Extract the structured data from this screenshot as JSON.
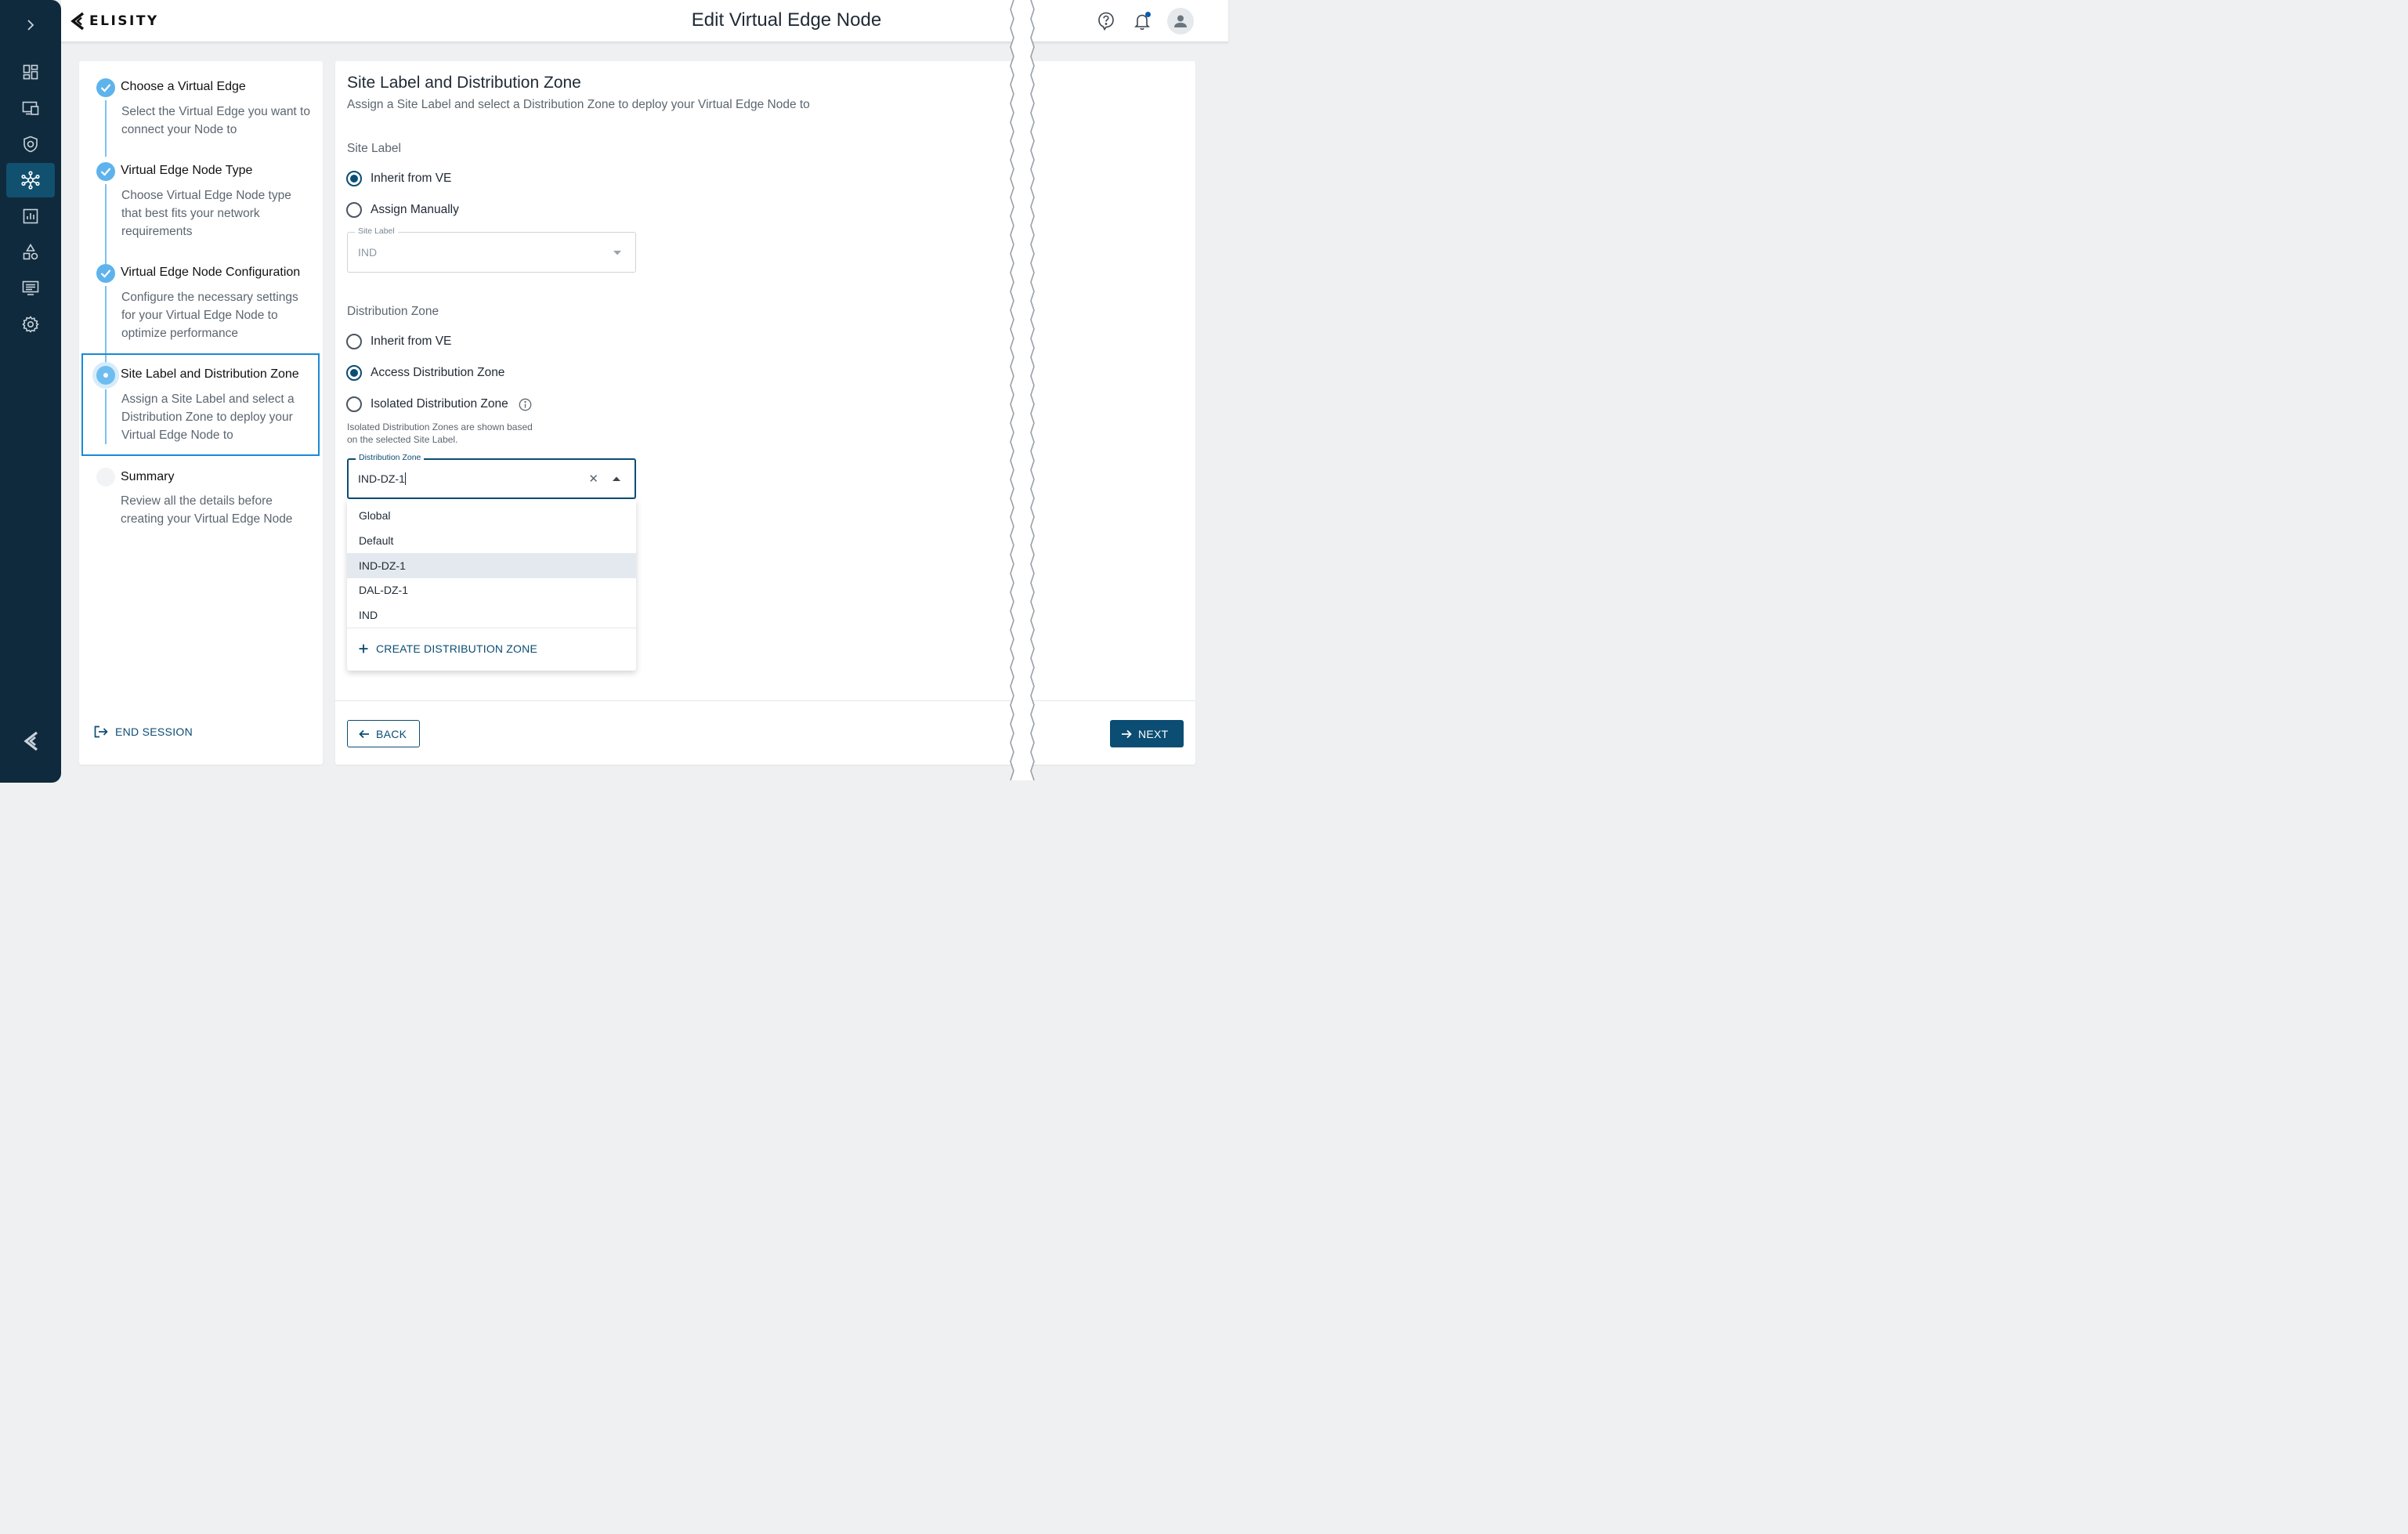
{
  "app": {
    "brand": "ELISITY",
    "page_title": "Edit Virtual Edge Node"
  },
  "rail": {
    "items": [
      "dashboard-icon",
      "devices-icon",
      "policy-shield-icon",
      "network-topology-icon",
      "analytics-icon",
      "shapes-icon",
      "monitor-list-icon",
      "settings-gear-icon"
    ],
    "active_index": 3
  },
  "stepper": {
    "steps": [
      {
        "title": "Choose a Virtual Edge",
        "desc": "Select the Virtual Edge you want to connect your Node to",
        "state": "done"
      },
      {
        "title": "Virtual Edge Node Type",
        "desc": "Choose Virtual Edge Node type that best fits your network requirements",
        "state": "done"
      },
      {
        "title": "Virtual Edge Node Configuration",
        "desc": "Configure the necessary settings for your Virtual Edge Node to optimize performance",
        "state": "done"
      },
      {
        "title": "Site Label and Distribution Zone",
        "desc": "Assign a Site Label and select a Distribution Zone to deploy your Virtual Edge Node to",
        "state": "current"
      },
      {
        "title": "Summary",
        "desc": "Review all the details before creating your Virtual Edge Node",
        "state": "pending"
      }
    ],
    "end_session_label": "END SESSION"
  },
  "main": {
    "title": "Site Label and Distribution Zone",
    "subtitle": "Assign a Site Label and select a Distribution Zone to deploy your Virtual Edge Node to",
    "site_label": {
      "heading": "Site Label",
      "options": [
        "Inherit from VE",
        "Assign Manually"
      ],
      "selected": "Inherit from VE",
      "field_label": "Site Label",
      "field_value": "IND"
    },
    "distribution_zone": {
      "heading": "Distribution Zone",
      "options": [
        "Inherit from VE",
        "Access Distribution Zone",
        "Isolated Distribution Zone"
      ],
      "selected": "Access Distribution Zone",
      "helper": "Isolated Distribution Zones are shown based on the selected Site Label.",
      "field_label": "Distribution Zone",
      "field_value": "IND-DZ-1",
      "dropdown_options": [
        "Global",
        "Default",
        "IND-DZ-1",
        "DAL-DZ-1",
        "IND"
      ],
      "highlighted_option": "IND-DZ-1",
      "create_label": "CREATE DISTRIBUTION ZONE"
    },
    "back_label": "BACK",
    "next_label": "NEXT"
  },
  "colors": {
    "rail_bg": "#0f2a3d",
    "primary": "#0b4d73",
    "step_done": "#5eb3ec",
    "focus_outline": "#1a8ad4"
  }
}
